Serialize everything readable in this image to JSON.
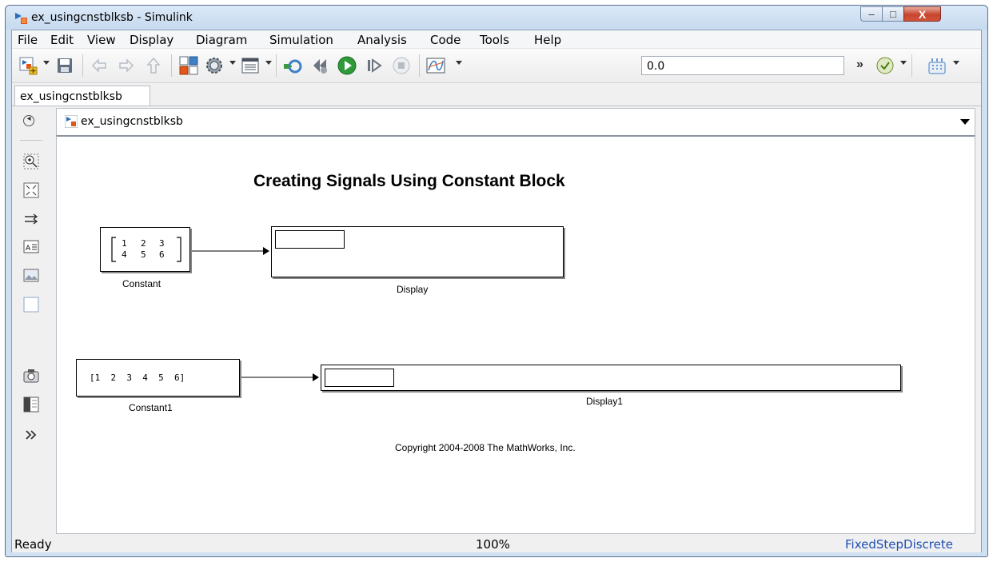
{
  "window": {
    "title": "ex_usingcnstblksb - Simulink",
    "controls": {
      "minimize": "–",
      "maximize": "□",
      "close": "X"
    }
  },
  "menu": [
    "File",
    "Edit",
    "View",
    "Display",
    "Diagram",
    "Simulation",
    "Analysis",
    "Code",
    "Tools",
    "Help"
  ],
  "toolbar": {
    "icons": [
      "new-model-icon",
      "save-icon",
      "back-icon",
      "forward-icon",
      "up-icon",
      "library-browser-icon",
      "model-settings-icon",
      "model-explorer-icon",
      "step-back-icon",
      "run-icon",
      "step-forward-icon",
      "stop-icon",
      "scope-icon",
      "check-icon",
      "build-icon"
    ],
    "stop_time": "0.0",
    "overflow": "»"
  },
  "tab": {
    "label": "ex_usingcnstblksb"
  },
  "address": {
    "label": "ex_usingcnstblksb"
  },
  "diagram": {
    "title": "Creating Signals Using Constant Block",
    "constant": {
      "label": "Constant",
      "row1": [
        "1",
        "2",
        "3"
      ],
      "row2": [
        "4",
        "5",
        "6"
      ]
    },
    "display": {
      "label": "Display"
    },
    "constant1": {
      "label": "Constant1",
      "value": "[1  2  3  4  5  6]"
    },
    "display1": {
      "label": "Display1"
    },
    "copyright": "Copyright 2004-2008 The MathWorks, Inc."
  },
  "palette": [
    "zoom-icon",
    "fit-view-icon",
    "route-lines-icon",
    "annotation-icon",
    "image-icon",
    "area-icon",
    "snapshot-icon",
    "model-browser-icon",
    "more-icon"
  ],
  "status": {
    "left": "Ready",
    "zoom": "100%",
    "solver": "FixedStepDiscrete"
  },
  "colors": {
    "titlebar": "#c6d9ee",
    "run": "#2e9a3a",
    "solver_text": "#1f4fb3"
  }
}
